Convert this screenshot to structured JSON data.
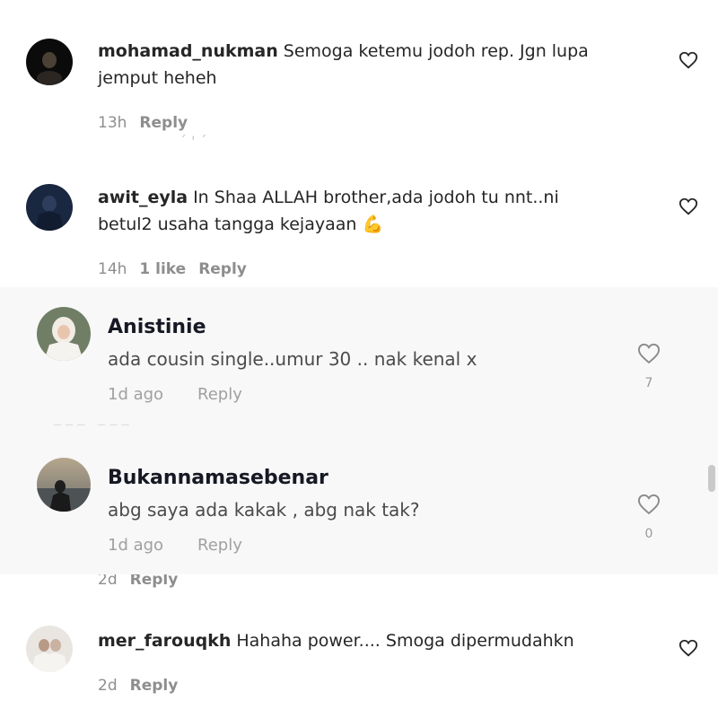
{
  "ig_comments": [
    {
      "username": "mohamad_nukman",
      "text": "Semoga ketemu jodoh rep. Jgn lupa jemput heheh",
      "time": "13h",
      "likes": "",
      "reply_label": "Reply",
      "like_icon": "heart-outline-icon"
    },
    {
      "username": "awit_eyla",
      "text": "In Shaa ALLAH brother,ada jodoh tu nnt..ni betul2 usaha tangga kejayaan 💪",
      "time": "14h",
      "likes": "1 like",
      "reply_label": "Reply",
      "like_icon": "heart-outline-icon"
    },
    {
      "username": "mer_farouqkh",
      "text": "Hahaha power.... Smoga dipermudahkn",
      "time": "2d",
      "likes": "",
      "reply_label": "Reply",
      "like_icon": "heart-outline-icon"
    }
  ],
  "ig_partial_row": {
    "time": "2d",
    "reply_label": "Reply"
  },
  "tt_comments": [
    {
      "username": "Anistinie",
      "text": "ada cousin single..umur 30 .. nak kenal x",
      "time": "1d ago",
      "reply_label": "Reply",
      "like_count": "7",
      "like_icon": "heart-outline-icon"
    },
    {
      "username": "Bukannamasebenar",
      "text": "abg saya ada kakak , abg nak tak?",
      "time": "1d ago",
      "reply_label": "Reply",
      "like_count": "0",
      "like_icon": "heart-outline-icon"
    }
  ],
  "colors": {
    "ig_background": "#ffffff",
    "tt_background": "#f8f8f8",
    "meta_gray": "#8e8e8e"
  }
}
